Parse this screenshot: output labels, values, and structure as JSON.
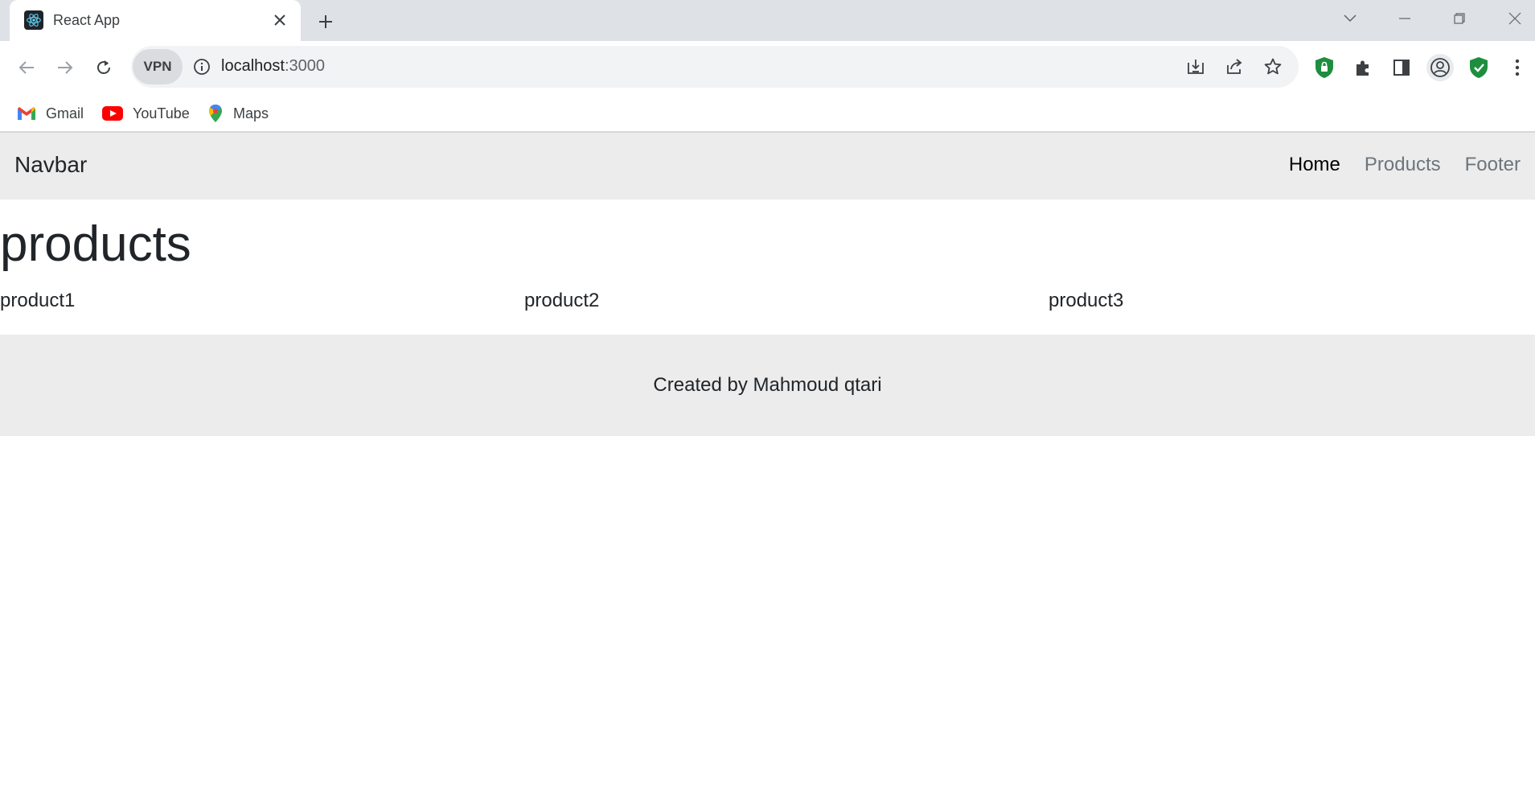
{
  "browser": {
    "tab": {
      "title": "React App"
    },
    "address_bar": {
      "host": "localhost",
      "port": ":3000",
      "vpn_label": "VPN"
    },
    "bookmarks": [
      {
        "label": "Gmail",
        "icon": "gmail-icon"
      },
      {
        "label": "YouTube",
        "icon": "youtube-icon"
      },
      {
        "label": "Maps",
        "icon": "maps-icon"
      }
    ],
    "colors": {
      "tabstrip": "#dee1e6",
      "omnibox": "#f1f3f4",
      "shield_green": "#1e8e3e"
    }
  },
  "navbar": {
    "brand": "Navbar",
    "links": [
      {
        "label": "Home",
        "active": true
      },
      {
        "label": "Products",
        "active": false
      },
      {
        "label": "Footer",
        "active": false
      }
    ]
  },
  "main": {
    "heading": "products",
    "products": [
      "product1",
      "product2",
      "product3"
    ]
  },
  "footer": {
    "text": "Created by Mahmoud qtari"
  },
  "colors": {
    "navbar_bg": "#ececec",
    "footer_bg": "#ececec",
    "text": "#212529",
    "muted_link": "#6c757d"
  }
}
